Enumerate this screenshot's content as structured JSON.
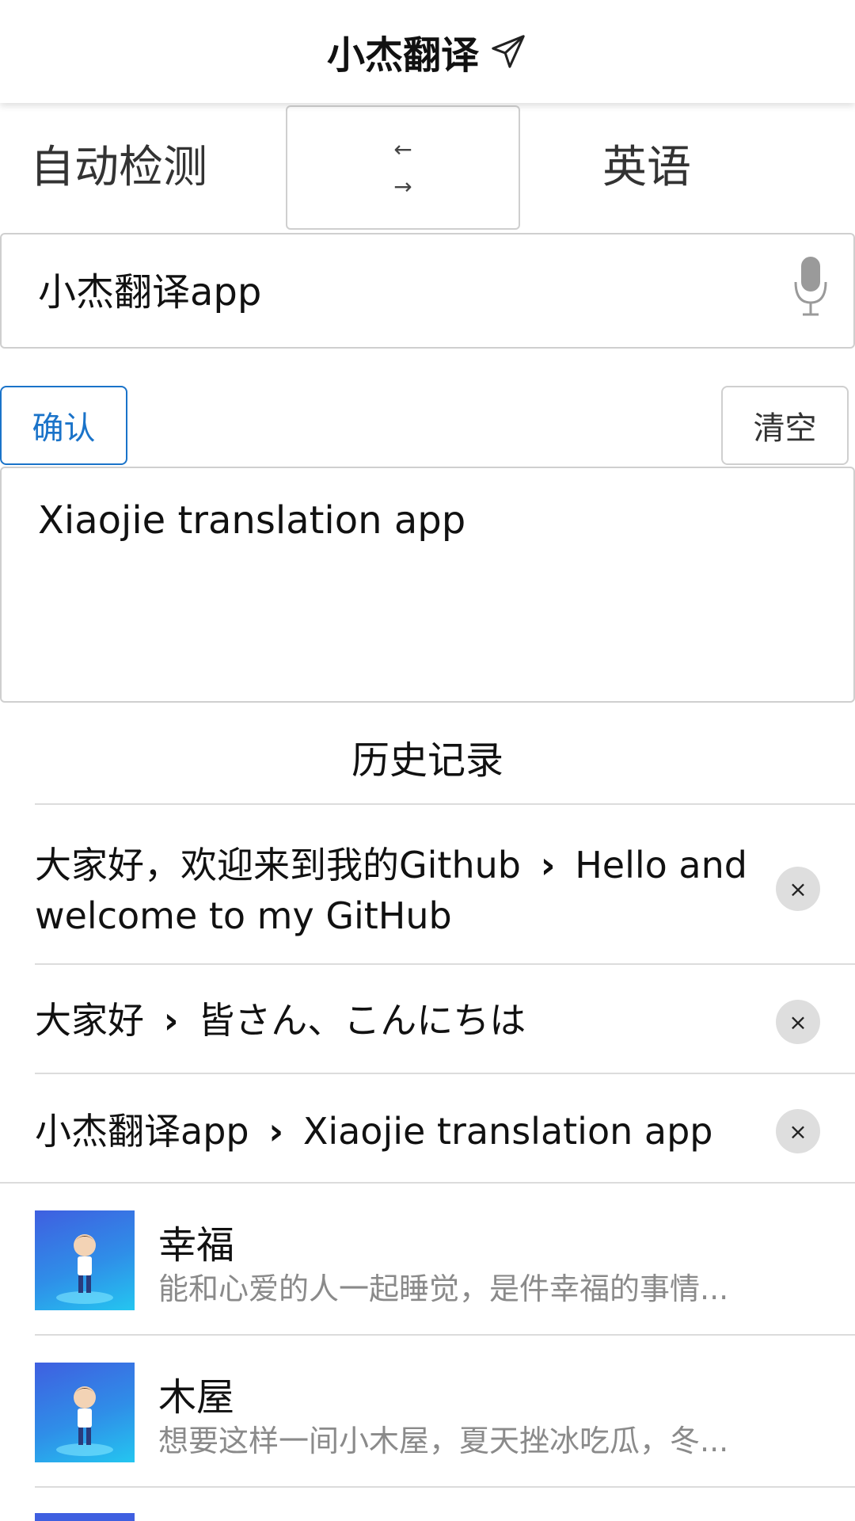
{
  "app": {
    "title": "小杰翻译"
  },
  "languages": {
    "source": "自动检测",
    "swap_top": "←",
    "swap_bottom": "→",
    "target": "英语"
  },
  "input": {
    "value": "小杰翻译app"
  },
  "buttons": {
    "confirm": "确认",
    "clear": "清空"
  },
  "output": {
    "value": "Xiaojie translation app"
  },
  "history": {
    "title": "历史记录",
    "separator": "›",
    "close": "×",
    "items": [
      {
        "source": "大家好，欢迎来到我的Github",
        "translation": "Hello and welcome to my GitHub"
      },
      {
        "source": "大家好",
        "translation": "皆さん、こんにちは"
      },
      {
        "source": "小杰翻译app",
        "translation": "Xiaojie translation app"
      }
    ]
  },
  "cards": [
    {
      "title": "幸福",
      "desc": "能和心爱的人一起睡觉，是件幸福的事情..."
    },
    {
      "title": "木屋",
      "desc": "想要这样一间小木屋，夏天挫冰吃瓜，冬..."
    }
  ],
  "colors": {
    "accent": "#1a73c9",
    "border": "#cfcfcf",
    "muted": "#8a8a8a"
  }
}
